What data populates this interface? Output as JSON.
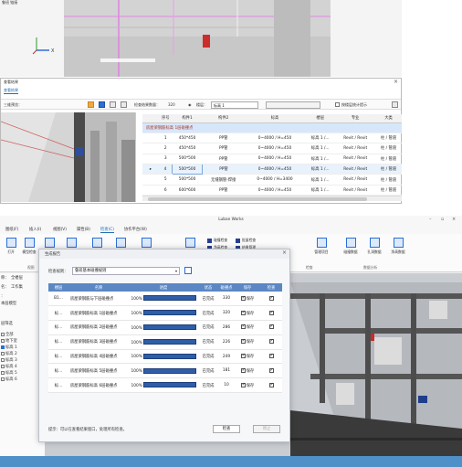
{
  "top_view": {
    "label": "鲁班 链接"
  },
  "check_dialog": {
    "title": "查看结果",
    "close": "×",
    "tab": "查看结果",
    "toolbar": {
      "view_label": "三维预览：",
      "count_label": "检查结果数量：",
      "count_value": "320",
      "floor_label": "楼层：",
      "floor_value": "标高 1",
      "hide_checkbox_label": "按楼层统计提示"
    },
    "table": {
      "headers": [
        "序号",
        "构件1",
        "构件2",
        "标高",
        "楼层",
        "专业",
        "大类"
      ],
      "group_row": "房屋梁钢筋标高 1层碰撞点",
      "rows": [
        [
          "1",
          "450*450",
          "PP管",
          "0~4000 / H=450",
          "标高 1 /...",
          "Revit / Revit",
          "柱 / 管道"
        ],
        [
          "2",
          "450*450",
          "PP管",
          "0~4000 / H=450",
          "标高 1 /...",
          "Revit / Revit",
          "柱 / 管道"
        ],
        [
          "3",
          "500*500",
          "PP管",
          "0~4000 / H=450",
          "标高 1 /...",
          "Revit / Revit",
          "柱 / 管道"
        ],
        [
          "4",
          "500*500",
          "PP管",
          "0~4000 / H=450",
          "标高 1 /...",
          "Revit / Revit",
          "柱 / 管道"
        ],
        [
          "5",
          "500*500",
          "无缝钢管-焊接",
          "0~4000 / H=3400",
          "标高 1 /...",
          "Revit / Revit",
          "柱 / 管道"
        ],
        [
          "6",
          "600*600",
          "PP管",
          "0~4000 / H=450",
          "标高 1 /...",
          "Revit / Revit",
          "柱 / 管道"
        ]
      ]
    }
  },
  "luban": {
    "title": "Luban Works",
    "window_controls": [
      "–",
      "▫",
      "×"
    ],
    "menu": [
      "图纸(F)",
      "插入(I)",
      "视图(V)",
      "属性(B)",
      "检查(C)",
      "协作平台(W)"
    ],
    "menu_active_index": 4,
    "ribbon_buttons": [
      "打开",
      "模型检查",
      "批量",
      "图",
      "图",
      "图",
      "图",
      "管理项目",
      "碰撞数据",
      "孔洞数据",
      "净高数据"
    ],
    "ribbon_small": [
      "碰撞检查",
      "净高检查",
      "孔洞检查",
      "批量检查",
      "结果管理",
      "报告导出"
    ],
    "ribbon_groups": [
      "视图",
      "检查",
      "数据分析"
    ],
    "sidebar": {
      "top_items": [
        "称：",
        "全楼层",
        "名：",
        "工作集",
        "：",
        "本层模型"
      ],
      "filter_label": "层筛选",
      "floors": [
        {
          "label": "全部",
          "checked": false
        },
        {
          "label": "地下室",
          "checked": false
        },
        {
          "label": "标高 1",
          "checked": true
        },
        {
          "label": "标高 2",
          "checked": false
        },
        {
          "label": "标高 3",
          "checked": false
        },
        {
          "label": "标高 4",
          "checked": false
        },
        {
          "label": "标高 5",
          "checked": false
        },
        {
          "label": "标高 6",
          "checked": false
        }
      ]
    }
  },
  "gen_dialog": {
    "title": "生成报告",
    "close": "×",
    "plan_label": "检查规则：",
    "plan_value": "鲁班基本碰撞规则",
    "headers": [
      "楼层",
      "名称",
      "进度",
      "状态",
      "碰撞点",
      "保存",
      "检查"
    ],
    "save_label": "保存",
    "rows": [
      {
        "floor": "B1...",
        "name": "房屋梁钢筋与下层碰撞点",
        "pct": "100%",
        "progress": 1.0,
        "status": "已完成",
        "count": "330",
        "save": true,
        "check": true
      },
      {
        "floor": "标...",
        "name": "房屋梁钢筋标高 1层碰撞点",
        "pct": "100%",
        "progress": 1.0,
        "status": "已完成",
        "count": "320",
        "save": true,
        "check": true
      },
      {
        "floor": "标...",
        "name": "房屋梁钢筋标高 2层碰撞点",
        "pct": "100%",
        "progress": 1.0,
        "status": "已完成",
        "count": "286",
        "save": true,
        "check": true
      },
      {
        "floor": "标...",
        "name": "房屋梁钢筋标高 3层碰撞点",
        "pct": "100%",
        "progress": 1.0,
        "status": "已完成",
        "count": "226",
        "save": true,
        "check": true
      },
      {
        "floor": "标...",
        "name": "房屋梁钢筋标高 4层碰撞点",
        "pct": "100%",
        "progress": 1.0,
        "status": "已完成",
        "count": "249",
        "save": true,
        "check": true
      },
      {
        "floor": "标...",
        "name": "房屋梁钢筋标高 5层碰撞点",
        "pct": "100%",
        "progress": 1.0,
        "status": "已完成",
        "count": "181",
        "save": true,
        "check": true
      },
      {
        "floor": "标...",
        "name": "房屋梁钢筋标高 6层碰撞点",
        "pct": "100%",
        "progress": 1.0,
        "status": "已完成",
        "count": "10",
        "save": true,
        "check": true
      }
    ],
    "footer_hint": "提示：可以在查看结果窗口，处理所有检查。",
    "btn_check": "检查",
    "btn_stop": "停止"
  },
  "colors": {
    "accent": "#2a6fd6",
    "progress": "#2f5ea8",
    "table_header": "#5b87c4",
    "statusbar": "#4f90c8"
  }
}
